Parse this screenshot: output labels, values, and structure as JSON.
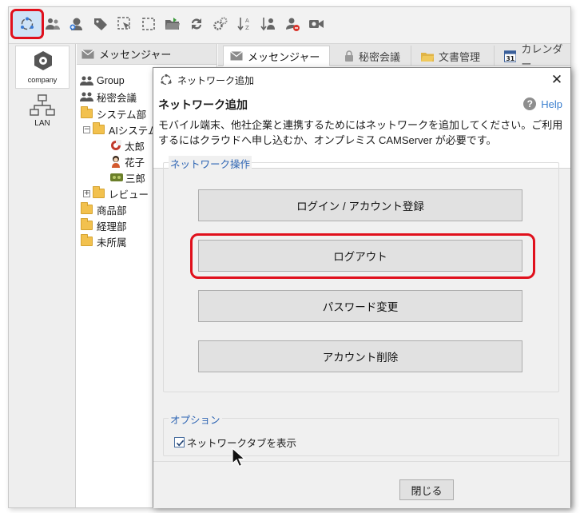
{
  "toolbar": {
    "buttons": [
      "network-add-icon",
      "users-icon",
      "add-user-icon",
      "tag-icon",
      "scan-icon",
      "select-icon",
      "folder-open-icon",
      "refresh-icon",
      "gears-icon",
      "sort-icon",
      "user-sort-icon",
      "user-remove-icon",
      "video-icon"
    ]
  },
  "leftbar": {
    "company_label": "company",
    "lan_label": "LAN"
  },
  "tree": {
    "header": "メッセンジャー",
    "items": [
      "Group",
      "秘密会議",
      "システム部",
      "AIシステム",
      "太郎",
      "花子",
      "三郎",
      "レビュー",
      "商品部",
      "経理部",
      "未所属"
    ]
  },
  "tabs": [
    "メッセンジャー",
    "秘密会議",
    "文書管理",
    "カレンダー"
  ],
  "tab_calendar_day": "31",
  "dialog": {
    "title": "ネットワーク追加",
    "heading": "ネットワーク追加",
    "help": "Help",
    "description": "モバイル端末、他社企業と連携するためにはネットワークを追加してください。ご利用するにはクラウドへ申し込むか、オンプレミス CAMServer が必要です。",
    "network_ops_label": "ネットワーク操作",
    "buttons": {
      "login": "ログイン / アカウント登録",
      "logout": "ログアウト",
      "password": "パスワード変更",
      "delete": "アカウント削除"
    },
    "options_label": "オプション",
    "checkbox_label": "ネットワークタブを表示",
    "checkbox_checked": true,
    "close_button": "閉じる"
  },
  "colors": {
    "highlight": "#e0101c",
    "link": "#3b7fcf",
    "group_label": "#2d64b3"
  }
}
